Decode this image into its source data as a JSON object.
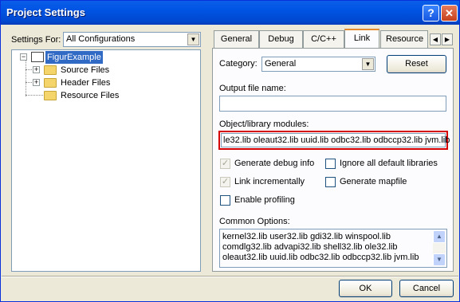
{
  "window": {
    "title": "Project Settings",
    "help_glyph": "?",
    "close_glyph": "✕"
  },
  "left": {
    "settings_for_label": "Settings For:",
    "settings_for_value": "All Configurations",
    "tree": [
      {
        "label": "FigurExample",
        "type": "project",
        "selected": true
      },
      {
        "label": "Source Files",
        "type": "folder"
      },
      {
        "label": "Header Files",
        "type": "folder"
      },
      {
        "label": "Resource Files",
        "type": "folder"
      }
    ]
  },
  "tabs": [
    "General",
    "Debug",
    "C/C++",
    "Link",
    "Resource"
  ],
  "active_tab": "Link",
  "link": {
    "category_label": "Category:",
    "category_value": "General",
    "reset_label": "Reset",
    "output_label": "Output file name:",
    "output_value": "",
    "modules_label": "Object/library modules:",
    "modules_value": "le32.lib oleaut32.lib uuid.lib odbc32.lib odbccp32.lib jvm.lib",
    "checkboxes": [
      {
        "label": "Generate debug info",
        "checked": true,
        "enabled": false
      },
      {
        "label": "Ignore all default libraries",
        "checked": false,
        "enabled": true
      },
      {
        "label": "Link incrementally",
        "checked": true,
        "enabled": false
      },
      {
        "label": "Generate mapfile",
        "checked": false,
        "enabled": true
      },
      {
        "label": "Enable profiling",
        "checked": false,
        "enabled": true
      }
    ],
    "common_label": "Common Options:",
    "common_lines": [
      "kernel32.lib user32.lib gdi32.lib winspool.lib",
      "comdlg32.lib advapi32.lib shell32.lib ole32.lib",
      "oleaut32.lib uuid.lib odbc32.lib odbccp32.lib jvm.lib"
    ]
  },
  "buttons": {
    "ok": "OK",
    "cancel": "Cancel"
  },
  "colors": {
    "title_bar": "#0054e3",
    "highlight_box": "#d40000",
    "active_tab_accent": "#e68b2c",
    "selection": "#316ac5"
  }
}
